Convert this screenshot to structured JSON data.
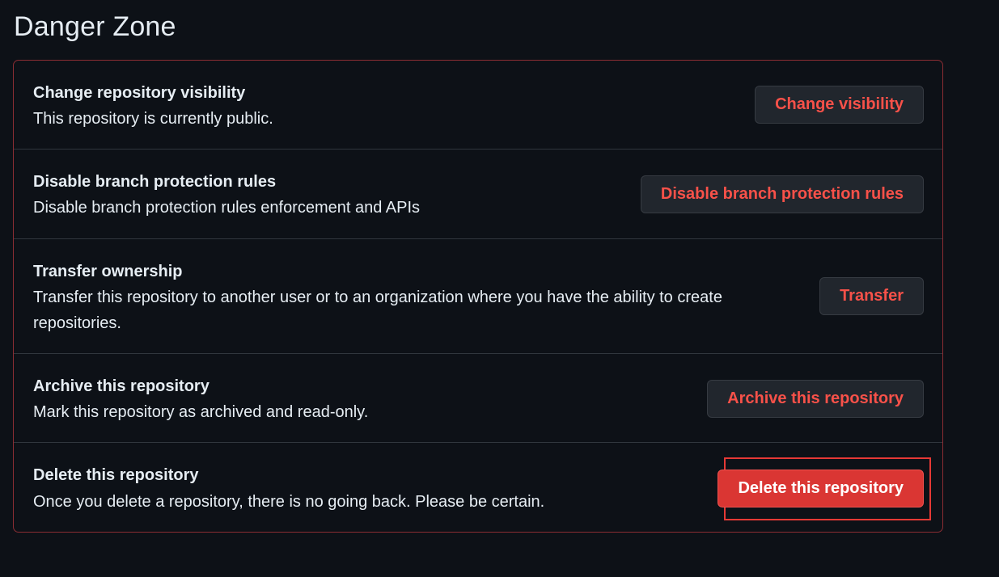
{
  "page": {
    "title": "Danger Zone"
  },
  "rows": [
    {
      "title": "Change repository visibility",
      "description": "This repository is currently public.",
      "button": "Change visibility"
    },
    {
      "title": "Disable branch protection rules",
      "description": "Disable branch protection rules enforcement and APIs",
      "button": "Disable branch protection rules"
    },
    {
      "title": "Transfer ownership",
      "description": "Transfer this repository to another user or to an organization where you have the ability to create repositories.",
      "button": "Transfer"
    },
    {
      "title": "Archive this repository",
      "description": "Mark this repository as archived and read-only.",
      "button": "Archive this repository"
    },
    {
      "title": "Delete this repository",
      "description": "Once you delete a repository, there is no going back. Please be certain.",
      "button": "Delete this repository"
    }
  ],
  "colors": {
    "background": "#0d1117",
    "danger_border": "#8b2d33",
    "danger_text": "#f85149",
    "danger_button": "#da3633",
    "highlight": "#e53935"
  }
}
